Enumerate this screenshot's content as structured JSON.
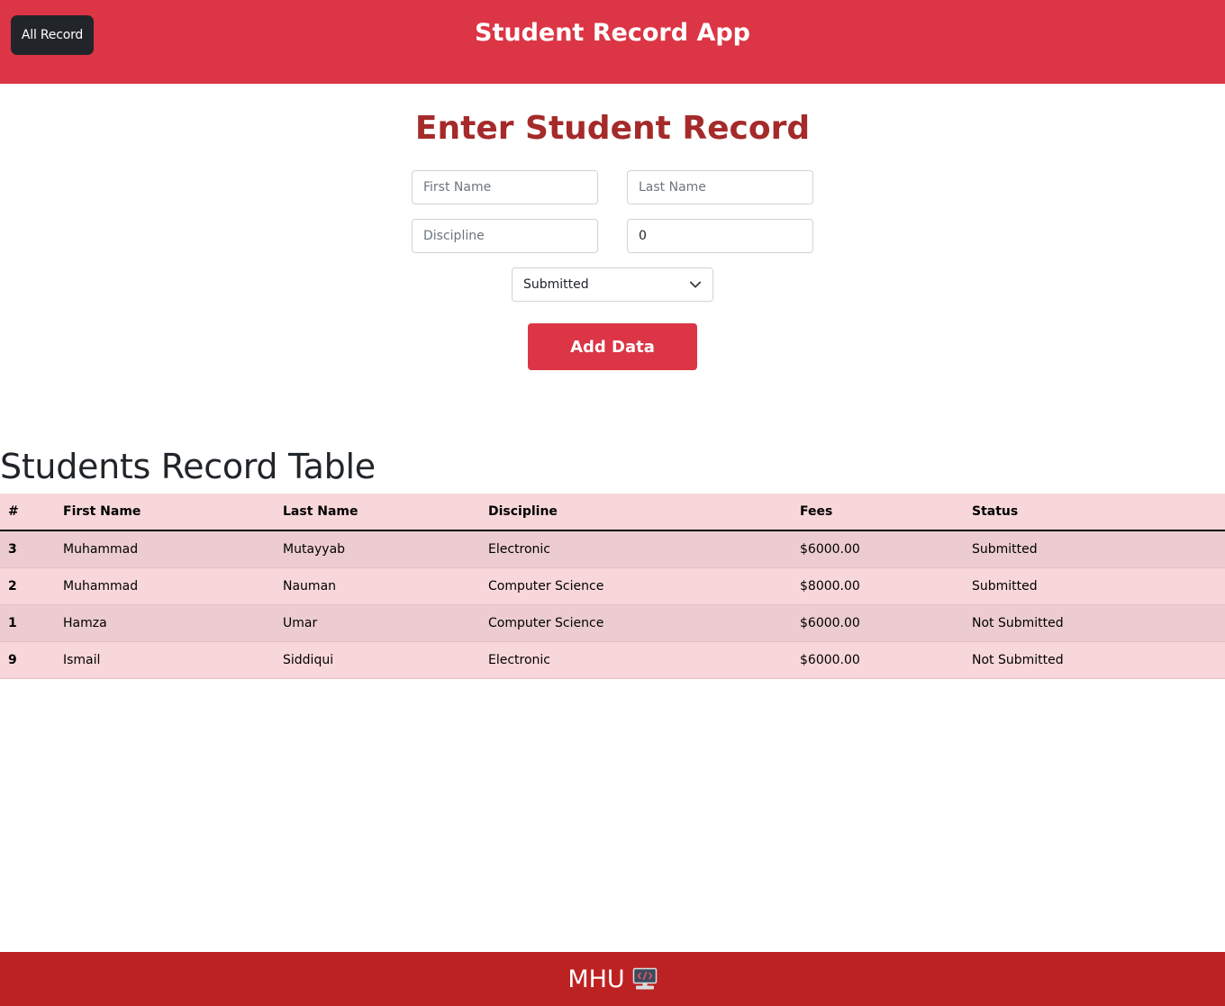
{
  "colors": {
    "brand": "#dc3545",
    "heading": "#a52a2a",
    "footer": "#bd2222",
    "row_light": "#f8d7da",
    "row_dark": "#ecccd0"
  },
  "navbar": {
    "all_record_label": "All Record",
    "title": "Student Record App"
  },
  "form": {
    "heading": "Enter Student Record",
    "first_name_placeholder": "First Name",
    "last_name_placeholder": "Last Name",
    "discipline_placeholder": "Discipline",
    "fees_value": "0",
    "status_selected": "Submitted",
    "status_icon": "chevron-down-icon",
    "submit_label": "Add Data"
  },
  "table": {
    "heading": "Students Record Table",
    "columns": [
      "#",
      "First Name",
      "Last Name",
      "Discipline",
      "Fees",
      "Status"
    ],
    "rows": [
      {
        "num": "3",
        "first": "Muhammad",
        "last": "Mutayyab",
        "discipline": "Electronic",
        "fees": "$6000.00",
        "status": "Submitted"
      },
      {
        "num": "2",
        "first": "Muhammad",
        "last": "Nauman",
        "discipline": "Computer Science",
        "fees": "$8000.00",
        "status": "Submitted"
      },
      {
        "num": "1",
        "first": "Hamza",
        "last": "Umar",
        "discipline": "Computer Science",
        "fees": "$6000.00",
        "status": "Not Submitted"
      },
      {
        "num": "9",
        "first": "Ismail",
        "last": "Siddiqui",
        "discipline": "Electronic",
        "fees": "$6000.00",
        "status": "Not Submitted"
      }
    ]
  },
  "footer": {
    "text": "MHU",
    "icon": "computer-code-icon"
  }
}
